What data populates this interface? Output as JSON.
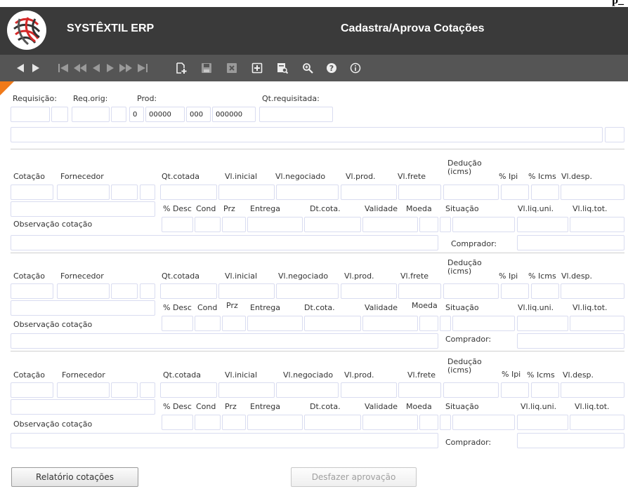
{
  "top_tag": "p_",
  "header": {
    "app_name": "SYSTÊXTIL ERP",
    "page_title": "Cadastra/Aprova Cotações"
  },
  "toolbar_icons": [
    "nav-back-icon",
    "nav-forward-icon",
    "first-record-icon",
    "fast-back-icon",
    "prev-record-icon",
    "next-record-icon",
    "fast-forward-icon",
    "last-record-icon",
    "new-record-icon",
    "save-icon",
    "delete-icon",
    "add-icon",
    "search-record-icon",
    "zoom-icon",
    "help-icon",
    "info-icon"
  ],
  "request": {
    "labels": {
      "requisicao": "Requisição:",
      "req_orig": "Req.orig:",
      "prod": "Prod:",
      "qt_requisitada": "Qt.requisitada:"
    },
    "prod_values": [
      "0",
      "00000",
      "000",
      "000000"
    ]
  },
  "quotation_labels": {
    "cotacao": "Cotação",
    "fornecedor": "Fornecedor",
    "qt_cotada": "Qt.cotada",
    "vl_inicial": "Vl.inicial",
    "vl_negociado": "Vl.negociado",
    "vl_prod": "Vl.prod.",
    "vl_frete": "Vl.frete",
    "deducao": "Dedução",
    "icms_paren": "(icms)",
    "pct_ipi": "% Ipi",
    "pct_icms": "% Icms",
    "vl_desp": "Vl.desp.",
    "pct_desc": "% Desc",
    "cond": "Cond",
    "prz": "Prz",
    "entrega": "Entrega",
    "dt_cota": "Dt.cota.",
    "validade": "Validade",
    "moeda": "Moeda",
    "situacao": "Situação",
    "vl_liq_uni": "Vl.liq.uni.",
    "vl_liq_tot": "Vl.liq.tot.",
    "observacao": "Observação cotação",
    "comprador": "Comprador:"
  },
  "buttons": {
    "relatorio": "Relatório cotações",
    "desfazer": "Desfazer aprovação"
  }
}
